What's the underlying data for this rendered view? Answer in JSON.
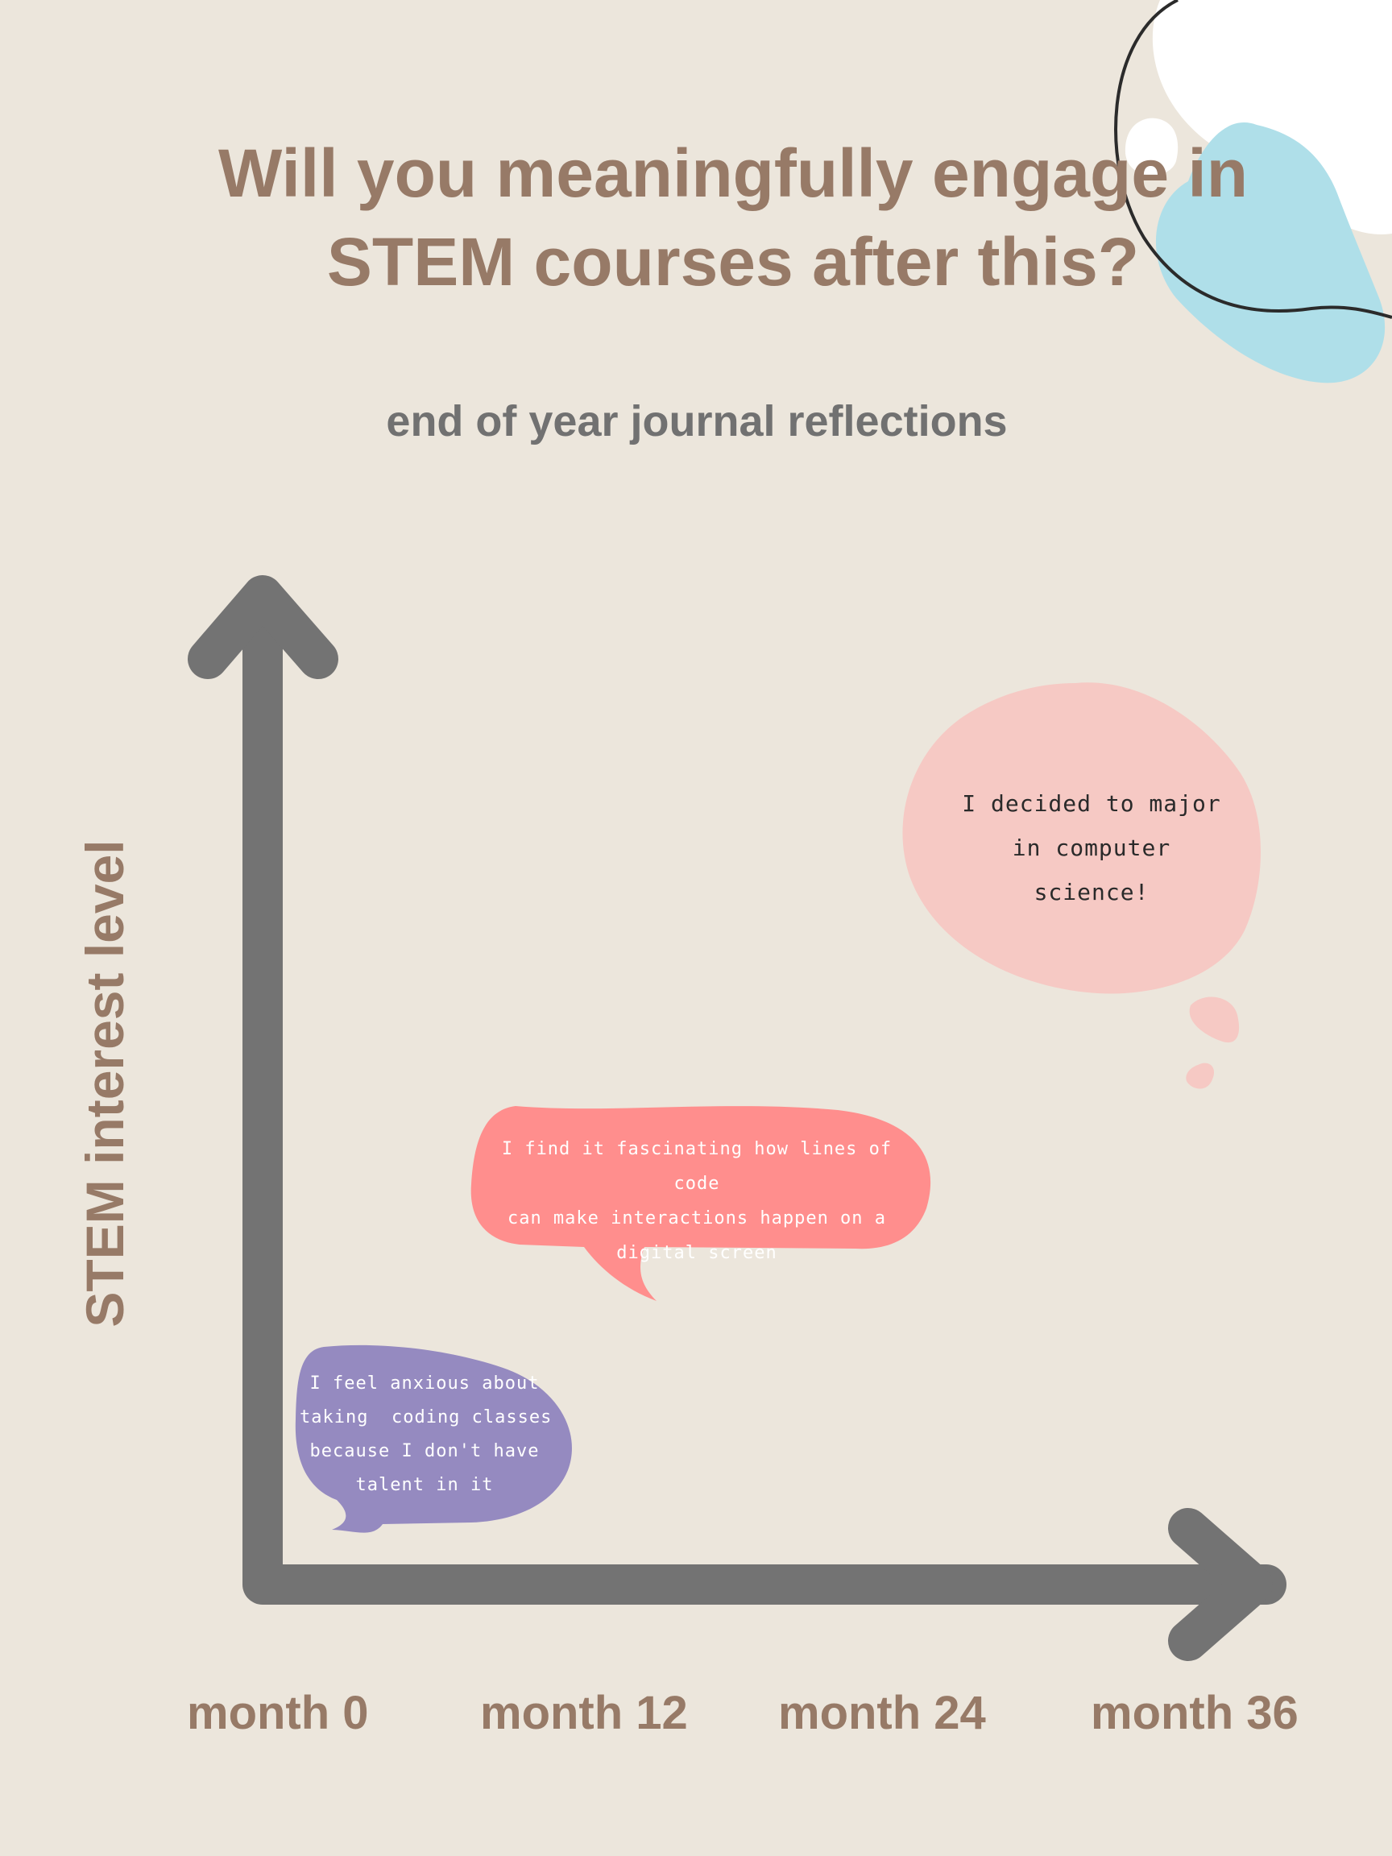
{
  "title": {
    "line1": "Will you meaningfully engage in",
    "line2": "STEM courses after this?"
  },
  "subtitle": "end of year journal reflections",
  "colors": {
    "background": "#ece6dc",
    "heading": "#977a67",
    "subtitle": "#717171",
    "axis": "#737373",
    "blob_blue": "#afdfe9",
    "bubble_purple": "#958ac0",
    "bubble_coral": "#ff8e8d",
    "bubble_pink": "#f6c9c4"
  },
  "chart_data": {
    "type": "scatter",
    "title": "",
    "ylabel": "STEM interest level",
    "xlabel": "",
    "x_ticks": [
      "month 0",
      "month 12",
      "month 24",
      "month 36"
    ],
    "points": [
      {
        "x": 6,
        "y": 0.2,
        "color": "#958ac0",
        "shape": "speech-bubble",
        "lines": [
          "I feel anxious about",
          "taking  coding classes",
          "because I don't have",
          "talent in it"
        ]
      },
      {
        "x": 15,
        "y": 0.47,
        "color": "#ff8e8d",
        "shape": "speech-bubble",
        "lines": [
          "I find it fascinating how lines of code",
          "can make interactions happen on a",
          "digital screen"
        ]
      },
      {
        "x": 32,
        "y": 0.87,
        "color": "#f6c9c4",
        "shape": "thought-bubble",
        "lines": [
          "I decided to major",
          "in computer",
          "science!"
        ]
      }
    ]
  }
}
